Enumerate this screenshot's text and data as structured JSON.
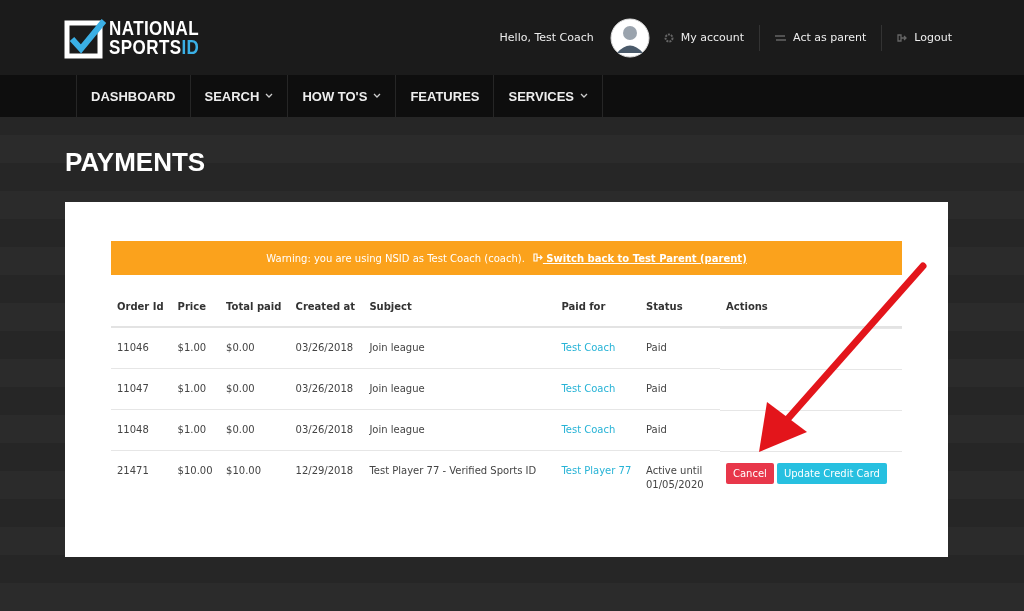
{
  "logo": {
    "line1": "NATIONAL",
    "line2": "SPORTS",
    "line2_accent": "ID"
  },
  "user_menu": {
    "greeting": "Hello, Test Coach",
    "links": [
      {
        "label": "My account",
        "kind": "account"
      },
      {
        "label": "Act as parent",
        "kind": "switch"
      },
      {
        "label": "Logout",
        "kind": "logout"
      }
    ]
  },
  "nav": [
    {
      "label": "DASHBOARD",
      "dropdown": false
    },
    {
      "label": "SEARCH",
      "dropdown": true
    },
    {
      "label": "HOW TO'S",
      "dropdown": true
    },
    {
      "label": "FEATURES",
      "dropdown": false
    },
    {
      "label": "SERVICES",
      "dropdown": true
    }
  ],
  "page_title": "PAYMENTS",
  "warning": {
    "text": "Warning: you are using NSID as Test Coach (coach).",
    "link": "Switch back to Test Parent (parent)"
  },
  "table": {
    "columns": [
      "Order Id",
      "Price",
      "Total paid",
      "Created at",
      "Subject",
      "Paid for",
      "Status",
      "Actions"
    ],
    "rows": [
      {
        "order_id": "11046",
        "price": "$1.00",
        "total_paid": "$0.00",
        "created_at": "03/26/2018",
        "subject": "Join league",
        "paid_for": "Test Coach",
        "status": "Paid",
        "actions": []
      },
      {
        "order_id": "11047",
        "price": "$1.00",
        "total_paid": "$0.00",
        "created_at": "03/26/2018",
        "subject": "Join league",
        "paid_for": "Test Coach",
        "status": "Paid",
        "actions": []
      },
      {
        "order_id": "11048",
        "price": "$1.00",
        "total_paid": "$0.00",
        "created_at": "03/26/2018",
        "subject": "Join league",
        "paid_for": "Test Coach",
        "status": "Paid",
        "actions": []
      },
      {
        "order_id": "21471",
        "price": "$10.00",
        "total_paid": "$10.00",
        "created_at": "12/29/2018",
        "subject": "Test Player 77 - Verified Sports ID",
        "paid_for": "Test Player 77",
        "status": "Active until 01/05/2020",
        "actions": [
          {
            "label": "Cancel",
            "kind": "danger"
          },
          {
            "label": "Update Credit Card",
            "kind": "info"
          }
        ]
      }
    ]
  }
}
